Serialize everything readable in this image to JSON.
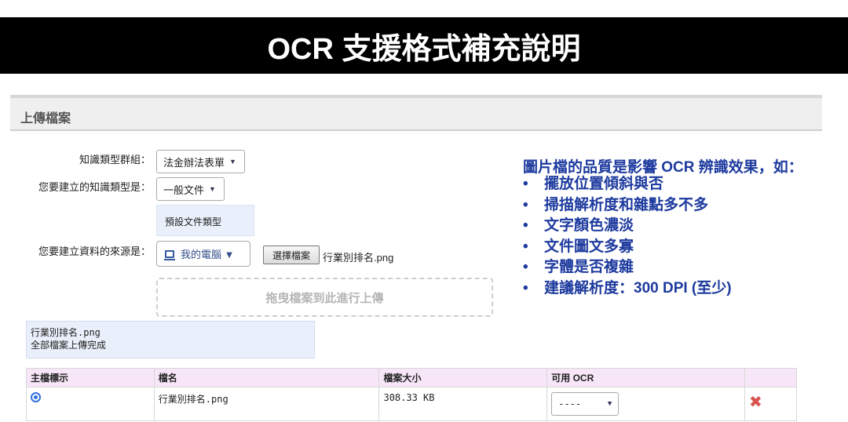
{
  "banner": {
    "title": "OCR 支援格式補充說明"
  },
  "panel": {
    "title": "上傳檔案"
  },
  "form": {
    "group_label": "知識類型群組：",
    "group_value": "法金辦法表單",
    "type_label": "您要建立的知識類型是：",
    "type_value": "一般文件",
    "default_type": "預設文件類型",
    "source_label": "您要建立資料的來源是：",
    "source_value": "我的電腦 ▼",
    "choose_file": "選擇檔案",
    "chosen_file": "行業別排名.png",
    "drop_zone": "拖曳檔案到此進行上傳",
    "upload_file": "行業別排名.png",
    "upload_status": "全部檔案上傳完成"
  },
  "info": {
    "title": "圖片檔的品質是影響 OCR 辨識效果，如：",
    "bullet": "•",
    "items": [
      "擺放位置傾斜與否",
      "掃描解析度和雜點多不多",
      "文字顏色濃淡",
      "文件圖文多寡",
      "字體是否複雜",
      "建議解析度：300 DPI (至少)"
    ]
  },
  "table": {
    "headers": [
      "主檔標示",
      "檔名",
      "檔案大小",
      "可用 OCR",
      ""
    ],
    "rows": [
      {
        "name": "行業別排名.png",
        "size": "308.33 KB",
        "ocr": "----"
      }
    ]
  },
  "icons": {
    "arrow": "▼",
    "delete": "✖"
  },
  "colors": {
    "accent": "#1d3a9e",
    "delete": "#d9534f",
    "header_bg": "#f7e6f7"
  }
}
